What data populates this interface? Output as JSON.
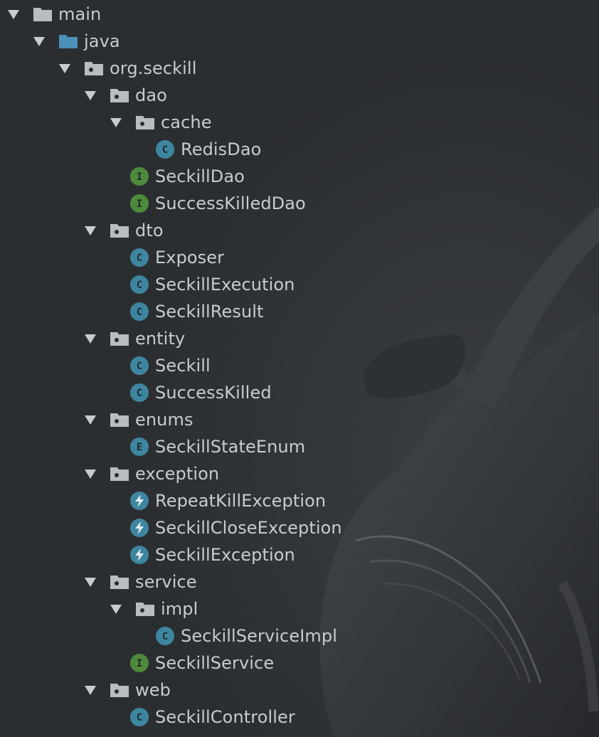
{
  "tree": [
    {
      "name": "main",
      "kind": "folder-gray",
      "depth": 0,
      "expanded": true
    },
    {
      "name": "java",
      "kind": "folder-blue",
      "depth": 1,
      "expanded": true
    },
    {
      "name": "org.seckill",
      "kind": "package",
      "depth": 2,
      "expanded": true
    },
    {
      "name": "dao",
      "kind": "package",
      "depth": 3,
      "expanded": true
    },
    {
      "name": "cache",
      "kind": "package",
      "depth": 4,
      "expanded": true
    },
    {
      "name": "RedisDao",
      "kind": "class",
      "depth": 5
    },
    {
      "name": "SeckillDao",
      "kind": "interface",
      "depth": 4
    },
    {
      "name": "SuccessKilledDao",
      "kind": "interface",
      "depth": 4
    },
    {
      "name": "dto",
      "kind": "package",
      "depth": 3,
      "expanded": true
    },
    {
      "name": "Exposer",
      "kind": "class",
      "depth": 4
    },
    {
      "name": "SeckillExecution",
      "kind": "class",
      "depth": 4
    },
    {
      "name": "SeckillResult",
      "kind": "class",
      "depth": 4
    },
    {
      "name": "entity",
      "kind": "package",
      "depth": 3,
      "expanded": true
    },
    {
      "name": "Seckill",
      "kind": "class",
      "depth": 4
    },
    {
      "name": "SuccessKilled",
      "kind": "class",
      "depth": 4
    },
    {
      "name": "enums",
      "kind": "package",
      "depth": 3,
      "expanded": true
    },
    {
      "name": "SeckillStateEnum",
      "kind": "enum",
      "depth": 4
    },
    {
      "name": "exception",
      "kind": "package",
      "depth": 3,
      "expanded": true
    },
    {
      "name": "RepeatKillException",
      "kind": "exception",
      "depth": 4
    },
    {
      "name": "SeckillCloseException",
      "kind": "exception",
      "depth": 4
    },
    {
      "name": "SeckillException",
      "kind": "exception",
      "depth": 4
    },
    {
      "name": "service",
      "kind": "package",
      "depth": 3,
      "expanded": true
    },
    {
      "name": "impl",
      "kind": "package",
      "depth": 4,
      "expanded": true
    },
    {
      "name": "SeckillServiceImpl",
      "kind": "class",
      "depth": 5
    },
    {
      "name": "SeckillService",
      "kind": "interface",
      "depth": 4
    },
    {
      "name": "web",
      "kind": "package",
      "depth": 3,
      "expanded": true
    },
    {
      "name": "SeckillController",
      "kind": "class",
      "depth": 4
    }
  ],
  "icons": {
    "class": {
      "name": "class-icon",
      "letter": "C",
      "color": "#3e86a0"
    },
    "interface": {
      "name": "interface-icon",
      "letter": "I",
      "color": "#4f8a3c"
    },
    "enum": {
      "name": "enum-icon",
      "letter": "E",
      "color": "#3e86a0"
    },
    "exception": {
      "name": "exception-icon",
      "color": "#3e86a0"
    },
    "package": {
      "name": "package-folder-icon",
      "color": "#b9bdc2"
    },
    "folder-gray": {
      "name": "folder-icon",
      "color": "#b9bdc2"
    },
    "folder-blue": {
      "name": "source-folder-icon",
      "color": "#4a90b8"
    }
  },
  "colors": {
    "background": "#2b2e31",
    "text": "#c8cbcf",
    "arrow": "#c8cbcf"
  }
}
